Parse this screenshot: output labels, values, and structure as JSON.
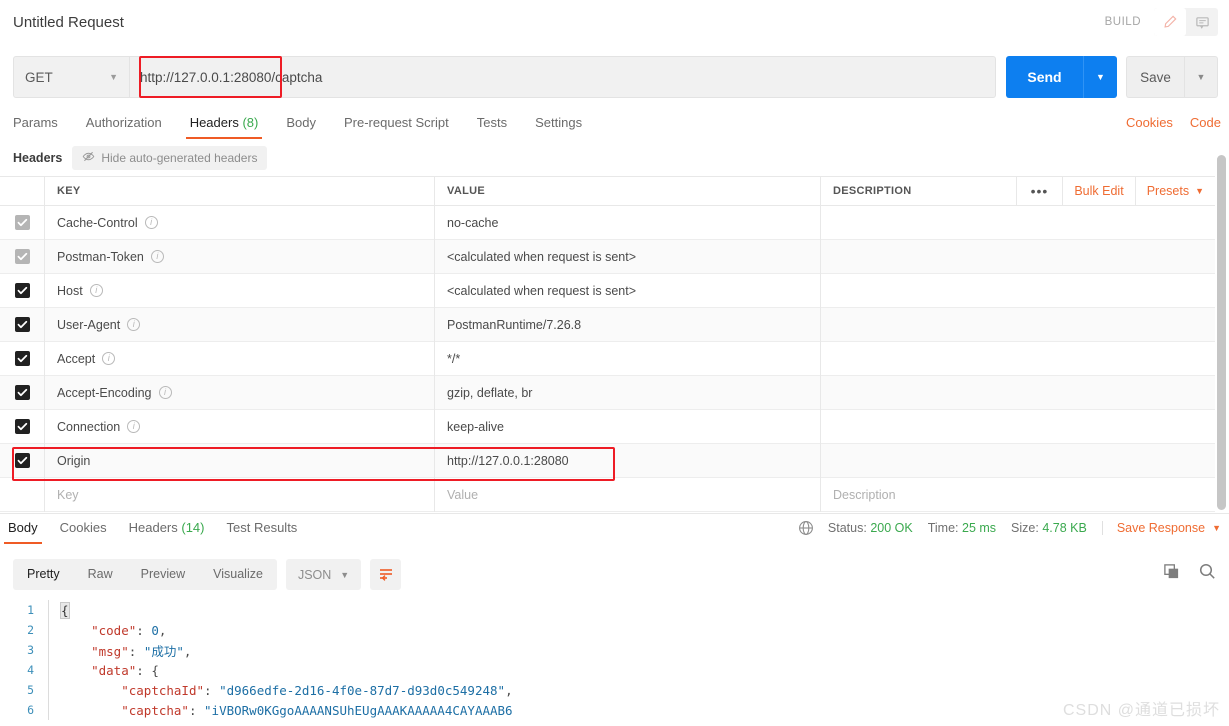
{
  "titlebar": {
    "request_title": "Untitled Request",
    "build_label": "BUILD",
    "edit_icon": "pencil-icon",
    "comment_icon": "comment-icon"
  },
  "url_row": {
    "method": "GET",
    "url_host": "http://127.0.0.1:28080",
    "url_path": "/captcha",
    "send_label": "Send",
    "save_label": "Save"
  },
  "request_tabs": [
    {
      "label": "Params",
      "count": "",
      "active": false
    },
    {
      "label": "Authorization",
      "count": "",
      "active": false
    },
    {
      "label": "Headers",
      "count": "(8)",
      "active": true
    },
    {
      "label": "Body",
      "count": "",
      "active": false
    },
    {
      "label": "Pre-request Script",
      "count": "",
      "active": false
    },
    {
      "label": "Tests",
      "count": "",
      "active": false
    },
    {
      "label": "Settings",
      "count": "",
      "active": false
    }
  ],
  "request_tabs_right": [
    {
      "label": "Cookies"
    },
    {
      "label": "Code"
    }
  ],
  "headers_section": {
    "title": "Headers",
    "hide_auto_label": "Hide auto-generated headers",
    "hide_auto_icon": "eye-off-icon",
    "columns": [
      "KEY",
      "VALUE",
      "DESCRIPTION"
    ],
    "actions": {
      "more_icon": "ellipsis-icon",
      "bulk_edit": "Bulk Edit",
      "presets": "Presets"
    },
    "rows": [
      {
        "checked": true,
        "dim": true,
        "key": "Cache-Control",
        "info": true,
        "value": "no-cache",
        "description": ""
      },
      {
        "checked": true,
        "dim": true,
        "key": "Postman-Token",
        "info": true,
        "value": "<calculated when request is sent>",
        "description": ""
      },
      {
        "checked": true,
        "dim": false,
        "key": "Host",
        "info": true,
        "value": "<calculated when request is sent>",
        "description": ""
      },
      {
        "checked": true,
        "dim": false,
        "key": "User-Agent",
        "info": true,
        "value": "PostmanRuntime/7.26.8",
        "description": ""
      },
      {
        "checked": true,
        "dim": false,
        "key": "Accept",
        "info": true,
        "value": "*/*",
        "description": ""
      },
      {
        "checked": true,
        "dim": false,
        "key": "Accept-Encoding",
        "info": true,
        "value": "gzip, deflate, br",
        "description": ""
      },
      {
        "checked": true,
        "dim": false,
        "key": "Connection",
        "info": true,
        "value": "keep-alive",
        "description": ""
      },
      {
        "checked": true,
        "dim": false,
        "key": "Origin",
        "info": false,
        "value": "http://127.0.0.1:28080",
        "description": ""
      }
    ],
    "new_row": {
      "key_placeholder": "Key",
      "value_placeholder": "Value",
      "description_placeholder": "Description"
    }
  },
  "response_tabs": [
    {
      "label": "Body",
      "count": "",
      "active": true
    },
    {
      "label": "Cookies",
      "count": "",
      "active": false
    },
    {
      "label": "Headers",
      "count": "(14)",
      "active": false
    },
    {
      "label": "Test Results",
      "count": "",
      "active": false
    }
  ],
  "response_meta": {
    "globe_icon": "globe-icon",
    "status_label": "Status:",
    "status_value": "200 OK",
    "time_label": "Time:",
    "time_value": "25 ms",
    "size_label": "Size:",
    "size_value": "4.78 KB",
    "save_response": "Save Response"
  },
  "body_toolbar": {
    "views": [
      "Pretty",
      "Raw",
      "Preview",
      "Visualize"
    ],
    "active_view": "Pretty",
    "format": "JSON",
    "wrap_icon": "word-wrap-icon",
    "copy_icon": "copy-icon",
    "search_icon": "search-icon"
  },
  "response_body": {
    "lines": [
      {
        "n": "1",
        "segments": [
          {
            "t": "{",
            "c": "brace-hl"
          }
        ]
      },
      {
        "n": "2",
        "segments": [
          {
            "t": "    ",
            "c": "k-punc"
          },
          {
            "t": "\"code\"",
            "c": "k-key"
          },
          {
            "t": ": ",
            "c": "k-punc"
          },
          {
            "t": "0",
            "c": "k-num"
          },
          {
            "t": ",",
            "c": "k-punc"
          }
        ]
      },
      {
        "n": "3",
        "segments": [
          {
            "t": "    ",
            "c": "k-punc"
          },
          {
            "t": "\"msg\"",
            "c": "k-key"
          },
          {
            "t": ": ",
            "c": "k-punc"
          },
          {
            "t": "\"成功\"",
            "c": "k-str"
          },
          {
            "t": ",",
            "c": "k-punc"
          }
        ]
      },
      {
        "n": "4",
        "segments": [
          {
            "t": "    ",
            "c": "k-punc"
          },
          {
            "t": "\"data\"",
            "c": "k-key"
          },
          {
            "t": ": {",
            "c": "k-punc"
          }
        ]
      },
      {
        "n": "5",
        "segments": [
          {
            "t": "        ",
            "c": "k-punc"
          },
          {
            "t": "\"captchaId\"",
            "c": "k-key"
          },
          {
            "t": ": ",
            "c": "k-punc"
          },
          {
            "t": "\"d966edfe-2d16-4f0e-87d7-d93d0c549248\"",
            "c": "k-str"
          },
          {
            "t": ",",
            "c": "k-punc"
          }
        ]
      },
      {
        "n": "6",
        "segments": [
          {
            "t": "        ",
            "c": "k-punc"
          },
          {
            "t": "\"captcha\"",
            "c": "k-key"
          },
          {
            "t": ": ",
            "c": "k-punc"
          },
          {
            "t": "\"iVBORw0KGgoAAAANSUhEUgAAAKAAAAA4CAYAAAB6",
            "c": "k-str"
          }
        ]
      }
    ]
  },
  "watermark": "CSDN @通道已损坏",
  "colors": {
    "accent_orange": "#ef5b25",
    "send_blue": "#0d7ff0",
    "status_green": "#3aa94e",
    "annotation_red": "#ee1c25"
  }
}
